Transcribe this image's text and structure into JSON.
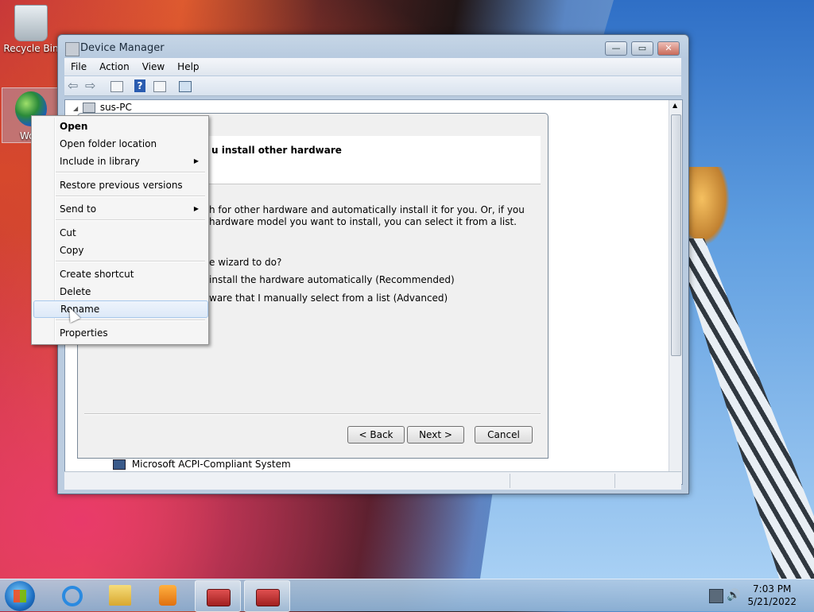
{
  "desktop": {
    "icons": [
      {
        "label": "Recycle Bin"
      },
      {
        "label": "Wo"
      }
    ]
  },
  "window": {
    "title": "Device Manager",
    "controls": {
      "minimize": "—",
      "maximize": "▭",
      "close": "✕"
    },
    "menu": [
      "File",
      "Action",
      "View",
      "Help"
    ],
    "tree": {
      "root": "sus-PC",
      "items": [
        "Microsoft ACPI-Compliant System"
      ]
    }
  },
  "wizard": {
    "header_title": "u install other hardware",
    "body_line1": "h for other hardware and automatically install it for you. Or, if you",
    "body_line2": "hardware model you want to install, you can select it from a list.",
    "question": "e wizard to do?",
    "option1": "install the hardware automatically (Recommended)",
    "option2": "ware that I manually select from a list (Advanced)",
    "buttons": {
      "back": "< Back",
      "next": "Next >",
      "cancel": "Cancel"
    }
  },
  "context_menu": {
    "items": [
      {
        "label": "Open",
        "bold": true
      },
      {
        "label": "Open folder location"
      },
      {
        "label": "Include in library",
        "submenu": true
      },
      {
        "label": "Restore previous versions"
      },
      {
        "label": "Send to",
        "submenu": true
      },
      {
        "label": "Cut"
      },
      {
        "label": "Copy"
      },
      {
        "label": "Create shortcut"
      },
      {
        "label": "Delete"
      },
      {
        "label": "Rename",
        "highlighted": true
      },
      {
        "label": "Properties"
      }
    ],
    "submenu_arrow": "▶"
  },
  "taskbar": {
    "time": "7:03 PM",
    "date": "5/21/2022"
  },
  "colors": {
    "accent": "#1e6fc2",
    "window_frame": "#b7cadf",
    "highlight": "#dde9f8"
  }
}
